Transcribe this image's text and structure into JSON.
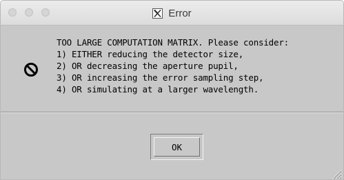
{
  "window": {
    "title": "Error",
    "title_icon": "x11-icon"
  },
  "dialog": {
    "icon": "no-entry-icon",
    "message": "TOO LARGE COMPUTATION MATRIX. Please consider:\n1) EITHER reducing the detector size,\n2) OR decreasing the aperture pupil,\n3) OR increasing the error sampling step,\n4) OR simulating at a larger wavelength.",
    "ok_label": "OK"
  },
  "colors": {
    "dialog_bg": "#c8c8c8",
    "titlebar_bg": "#e2e2e2",
    "text": "#000000"
  }
}
